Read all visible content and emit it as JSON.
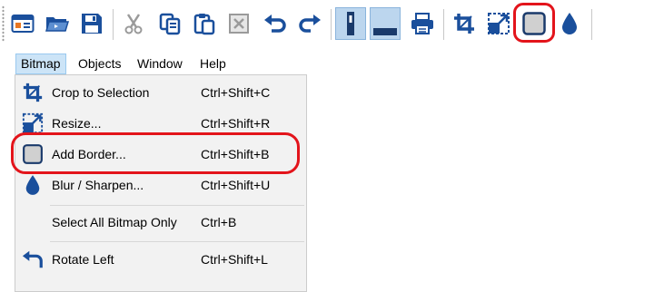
{
  "toolbar": {
    "buttons": [
      {
        "icon": "new-window-icon"
      },
      {
        "icon": "open-folder-icon"
      },
      {
        "icon": "save-icon"
      },
      {
        "icon": "cut-icon"
      },
      {
        "icon": "copy-icon"
      },
      {
        "icon": "paste-icon"
      },
      {
        "icon": "delete-icon"
      },
      {
        "icon": "undo-icon"
      },
      {
        "icon": "redo-icon"
      },
      {
        "icon": "vertical-layout-icon"
      },
      {
        "icon": "horizontal-layout-icon"
      },
      {
        "icon": "print-icon"
      },
      {
        "icon": "crop-icon"
      },
      {
        "icon": "resize-icon"
      },
      {
        "icon": "add-border-icon"
      },
      {
        "icon": "blur-sharpen-icon"
      }
    ]
  },
  "menubar": {
    "items": [
      "Bitmap",
      "Objects",
      "Window",
      "Help"
    ],
    "open": "Bitmap"
  },
  "bitmap_menu": {
    "items": [
      {
        "label": "Crop to Selection",
        "shortcut": "Ctrl+Shift+C",
        "icon": "crop-icon"
      },
      {
        "label": "Resize...",
        "shortcut": "Ctrl+Shift+R",
        "icon": "resize-icon"
      },
      {
        "label": "Add Border...",
        "shortcut": "Ctrl+Shift+B",
        "icon": "add-border-icon"
      },
      {
        "label": "Blur / Sharpen...",
        "shortcut": "Ctrl+Shift+U",
        "icon": "blur-sharpen-icon"
      },
      {
        "label": "Select All Bitmap Only",
        "shortcut": "Ctrl+B",
        "icon": ""
      },
      {
        "label": "Rotate Left",
        "shortcut": "Ctrl+Shift+L",
        "icon": "rotate-left-icon"
      }
    ]
  },
  "colors": {
    "highlight": "#e3141b",
    "accent_blue": "#1a4f9c",
    "active_button": "#bcd6ee",
    "menu_background": "#f2f2f2"
  }
}
